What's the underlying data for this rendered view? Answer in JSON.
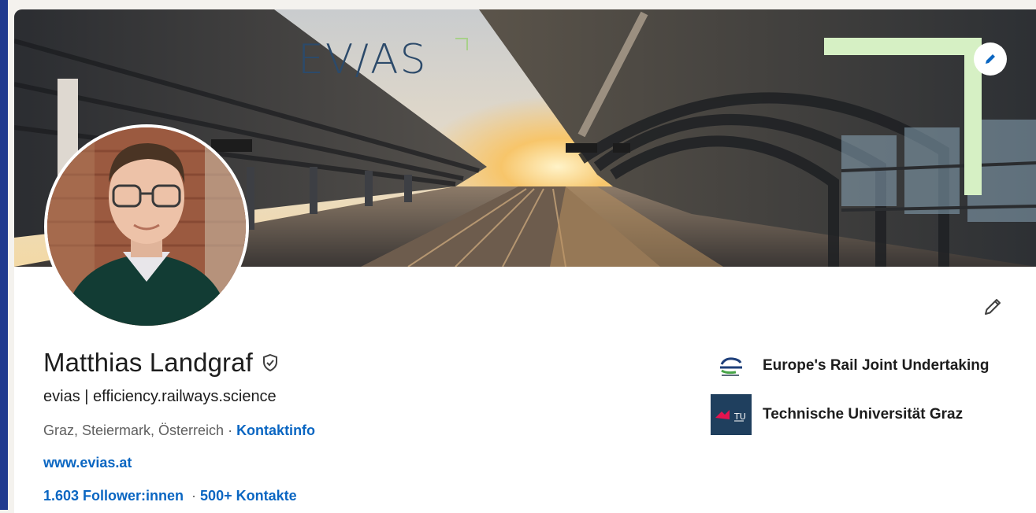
{
  "banner": {
    "logo_text": "evias",
    "logo_display": "EV/AS",
    "accent_color": "#a8d08a"
  },
  "profile": {
    "name": "Matthias Landgraf",
    "headline": "evias | efficiency.railways.science",
    "location": "Graz, Steiermark, Österreich",
    "location_separator": " · ",
    "contact_info_label": "Kontaktinfo",
    "website": "www.evias.at",
    "followers": "1.603 Follower:innen",
    "stats_separator": "  · ",
    "connections": "500+ Kontakte"
  },
  "organizations": [
    {
      "name": "Europe's Rail Joint Undertaking",
      "icon": "europes-rail-logo"
    },
    {
      "name": "Technische Universität Graz",
      "icon": "tu-graz-logo"
    }
  ],
  "icons": {
    "banner_edit": "pencil-icon",
    "profile_edit": "pencil-icon",
    "verified": "shield-check-icon"
  },
  "colors": {
    "link": "#0a66c2",
    "text": "#1d1d1d",
    "muted": "#5f5f5f",
    "edge": "#203b8f"
  }
}
